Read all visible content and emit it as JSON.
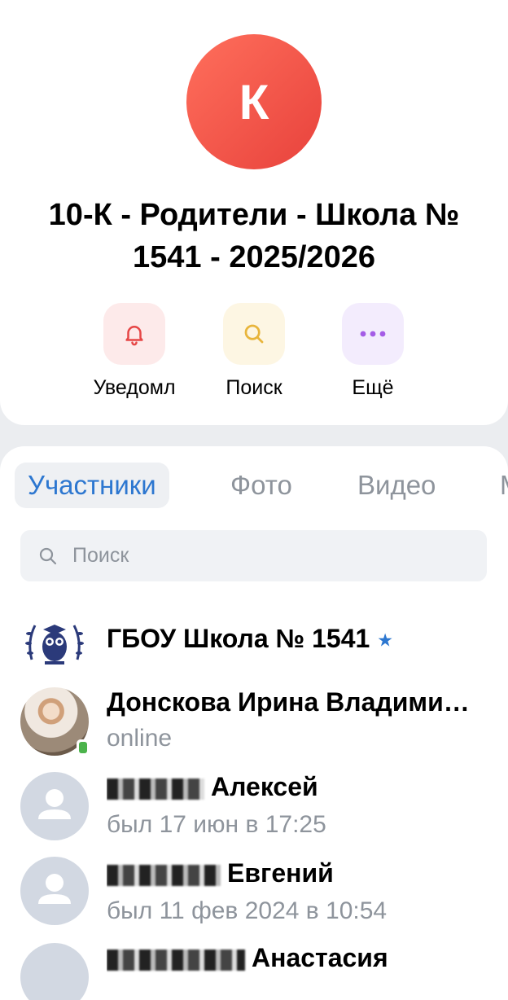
{
  "chat": {
    "avatar_letter": "К",
    "title": "10-К - Родители - Школа № 1541 - 2025/2026"
  },
  "actions": [
    {
      "label": "Уведомл",
      "icon": "bell-icon",
      "bg": "#fdeaea",
      "color": "#e64646"
    },
    {
      "label": "Поиск",
      "icon": "search-icon",
      "bg": "#fdf6e3",
      "color": "#e8b53c"
    },
    {
      "label": "Ещё",
      "icon": "more-icon",
      "bg": "#f3ecfd",
      "color": "#a45ce6"
    }
  ],
  "tabs": [
    {
      "label": "Участники",
      "active": true
    },
    {
      "label": "Фото",
      "active": false
    },
    {
      "label": "Видео",
      "active": false
    },
    {
      "label": "М",
      "active": false
    }
  ],
  "search": {
    "placeholder": "Поиск"
  },
  "members": [
    {
      "name": "ГБОУ Школа № 1541",
      "status": "",
      "verified": true,
      "avatar": "school-logo"
    },
    {
      "name": "Донскова Ирина Владимировна",
      "status": "online",
      "online": true,
      "avatar": "photo"
    },
    {
      "name": "Алексей",
      "status": "был 17 июн в 17:25",
      "avatar": "default"
    },
    {
      "name": "Евгений",
      "status": "был 11 фев 2024 в 10:54",
      "avatar": "default"
    },
    {
      "name": "Анастасия",
      "status": "",
      "avatar": "default"
    }
  ],
  "colors": {
    "accent": "#2d77d0",
    "avatar_gradient_start": "#ff6f5c",
    "avatar_gradient_end": "#e8423c",
    "online": "#4bb34b"
  }
}
